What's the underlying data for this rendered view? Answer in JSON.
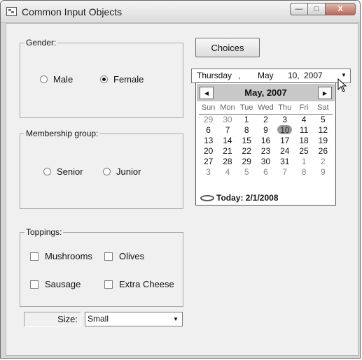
{
  "window": {
    "title": "Common Input Objects",
    "controls": {
      "minimize": "—",
      "maximize": "□",
      "close": "X"
    }
  },
  "gender": {
    "label": "Gender:",
    "options": [
      "Male",
      "Female"
    ],
    "selected": "Female"
  },
  "membership": {
    "label": "Membership group:",
    "options": [
      "Senior",
      "Junior"
    ],
    "selected": null
  },
  "toppings": {
    "label": "Toppings:",
    "items": [
      "Mushrooms",
      "Olives",
      "Sausage",
      "Extra Cheese"
    ]
  },
  "size": {
    "label": "Size:",
    "value": "Small"
  },
  "choices_button": "Choices",
  "datepicker": {
    "day_name": "Thursday",
    "separator": ",",
    "month": "May",
    "day": "10,",
    "year": "2007"
  },
  "calendar": {
    "month_label": "May, 2007",
    "weekdays": [
      "Sun",
      "Mon",
      "Tue",
      "Wed",
      "Thu",
      "Fri",
      "Sat"
    ],
    "weeks": [
      [
        {
          "d": "29",
          "dim": true
        },
        {
          "d": "30",
          "dim": true
        },
        {
          "d": "1"
        },
        {
          "d": "2"
        },
        {
          "d": "3"
        },
        {
          "d": "4"
        },
        {
          "d": "5"
        }
      ],
      [
        {
          "d": "6"
        },
        {
          "d": "7"
        },
        {
          "d": "8"
        },
        {
          "d": "9"
        },
        {
          "d": "10",
          "sel": true
        },
        {
          "d": "11"
        },
        {
          "d": "12"
        }
      ],
      [
        {
          "d": "13"
        },
        {
          "d": "14"
        },
        {
          "d": "15"
        },
        {
          "d": "16"
        },
        {
          "d": "17"
        },
        {
          "d": "18"
        },
        {
          "d": "19"
        }
      ],
      [
        {
          "d": "20"
        },
        {
          "d": "21"
        },
        {
          "d": "22"
        },
        {
          "d": "23"
        },
        {
          "d": "24"
        },
        {
          "d": "25"
        },
        {
          "d": "26"
        }
      ],
      [
        {
          "d": "27"
        },
        {
          "d": "28"
        },
        {
          "d": "29"
        },
        {
          "d": "30"
        },
        {
          "d": "31"
        },
        {
          "d": "1",
          "dim": true
        },
        {
          "d": "2",
          "dim": true
        }
      ],
      [
        {
          "d": "3",
          "dim": true
        },
        {
          "d": "4",
          "dim": true
        },
        {
          "d": "5",
          "dim": true
        },
        {
          "d": "6",
          "dim": true
        },
        {
          "d": "7",
          "dim": true
        },
        {
          "d": "8",
          "dim": true
        },
        {
          "d": "9",
          "dim": true
        }
      ]
    ],
    "today_label": "Today: 2/1/2008"
  },
  "icons": {
    "prev": "left-arrow-icon",
    "next": "right-arrow-icon",
    "dropdown": "dropdown-arrow-icon",
    "pointer": "mouse-pointer-icon"
  }
}
